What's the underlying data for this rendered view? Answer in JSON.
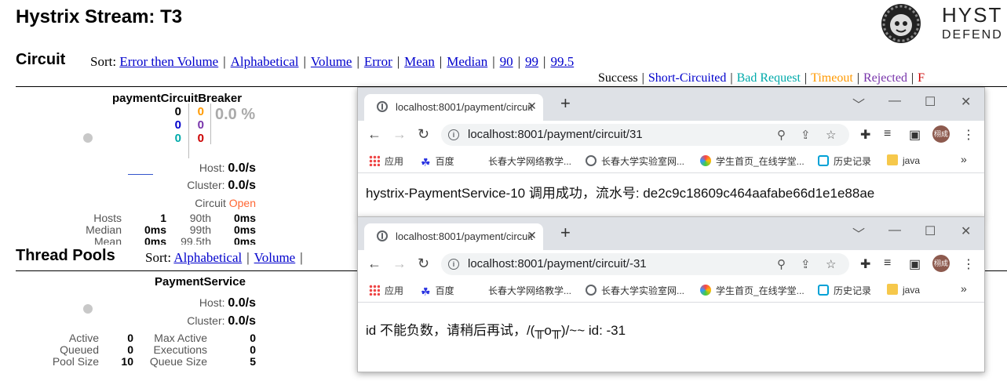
{
  "page": {
    "title": "Hystrix Stream: T3",
    "logo_text_top": "HYST",
    "logo_text_bottom": "DEFEND"
  },
  "circuit": {
    "section_title": "Circuit",
    "sort_label": "Sort:",
    "sort_options": [
      "Error then Volume",
      "Alphabetical",
      "Volume",
      "Error",
      "Mean",
      "Median",
      "90",
      "99",
      "99.5"
    ],
    "legend": [
      {
        "label": "Success",
        "color": "#000000"
      },
      {
        "label": "Short-Circuited",
        "color": "#0000cc"
      },
      {
        "label": "Bad Request",
        "color": "#00aaaa"
      },
      {
        "label": "Timeout",
        "color": "#ff9900"
      },
      {
        "label": "Rejected",
        "color": "#7733aa"
      },
      {
        "label": "F",
        "color": "#cc0000"
      }
    ],
    "card": {
      "name": "paymentCircuitBreaker",
      "counts_col1": [
        {
          "v": "0",
          "color": "#000000"
        },
        {
          "v": "0",
          "color": "#0000cc"
        },
        {
          "v": "0",
          "color": "#00aaaa"
        }
      ],
      "counts_col2": [
        {
          "v": "0",
          "color": "#ff9900"
        },
        {
          "v": "0",
          "color": "#7733aa"
        },
        {
          "v": "0",
          "color": "#cc0000"
        }
      ],
      "error_pct": "0.0 %",
      "host_label": "Host:",
      "host_rate": "0.0/s",
      "cluster_label": "Cluster:",
      "cluster_rate": "0.0/s",
      "circuit_label": "Circuit",
      "circuit_status": "Open",
      "stats": [
        {
          "l1": "Hosts",
          "v1": "1",
          "l2": "90th",
          "v2": "0ms"
        },
        {
          "l1": "Median",
          "v1": "0ms",
          "l2": "99th",
          "v2": "0ms"
        },
        {
          "l1": "Mean",
          "v1": "0ms",
          "l2": "99.5th",
          "v2": "0ms"
        }
      ]
    }
  },
  "thread_pools": {
    "section_title": "Thread Pools",
    "sort_label": "Sort:",
    "sort_options": [
      "Alphabetical",
      "Volume"
    ],
    "card": {
      "name": "PaymentService",
      "host_label": "Host:",
      "host_rate": "0.0/s",
      "cluster_label": "Cluster:",
      "cluster_rate": "0.0/s",
      "stats": [
        {
          "l1": "Active",
          "v1": "0",
          "l2": "Max Active",
          "v2": "0"
        },
        {
          "l1": "Queued",
          "v1": "0",
          "l2": "Executions",
          "v2": "0"
        },
        {
          "l1": "Pool Size",
          "v1": "10",
          "l2": "Queue Size",
          "v2": "5"
        }
      ]
    }
  },
  "bookmarks": [
    {
      "label": "应用",
      "icon": "apps-grid-icon"
    },
    {
      "label": "百度",
      "icon": "baidu-paw-icon"
    },
    {
      "label": "长春大学网络教学...",
      "icon": "blank-page-icon"
    },
    {
      "label": "长春大学实验室网...",
      "icon": "globe-icon"
    },
    {
      "label": "学生首页_在线学堂...",
      "icon": "colorful-leaf-icon"
    },
    {
      "label": "历史记录",
      "icon": "bilibili-tv-icon"
    },
    {
      "label": "java",
      "icon": "folder-icon"
    }
  ],
  "windows": [
    {
      "tab_title": "localhost:8001/payment/circuit",
      "url": "localhost:8001/payment/circuit/31",
      "avatar_text": "栩成",
      "content": "hystrix-PaymentService-10 调用成功，流水号: de2c9c18609c464aafabe66d1e1e88ae"
    },
    {
      "tab_title": "localhost:8001/payment/circuit",
      "url": "localhost:8001/payment/circuit/-31",
      "avatar_text": "栩成",
      "content": "id 不能负数，请稍后再试，/(╥o╥)/~~ id: -31"
    }
  ]
}
